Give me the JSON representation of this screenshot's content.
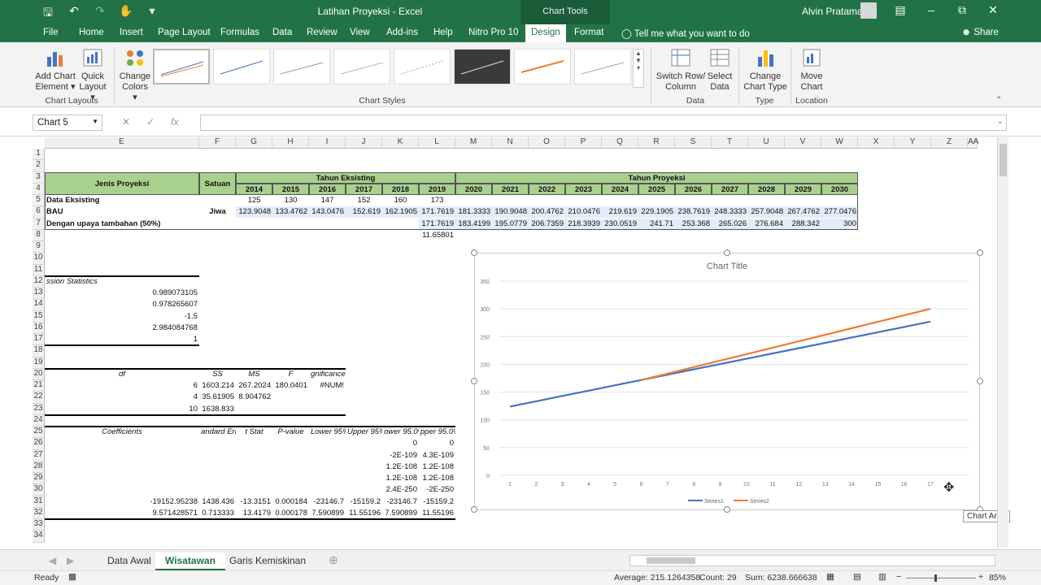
{
  "window": {
    "title": "Latihan Proyeksi  -  Excel",
    "contextual_tab": "Chart Tools",
    "user": "Alvin Pratama"
  },
  "tabs": [
    "File",
    "Home",
    "Insert",
    "Page Layout",
    "Formulas",
    "Data",
    "Review",
    "View",
    "Add-ins",
    "Help",
    "Nitro Pro 10",
    "Design",
    "Format"
  ],
  "tell_me": "Tell me what you want to do",
  "share": "Share",
  "ribbon": {
    "add_chart": "Add Chart",
    "add_chart2": "Element",
    "quick": "Quick",
    "quick2": "Layout",
    "change_colors": "Change",
    "change_colors2": "Colors",
    "group_layouts": "Chart Layouts",
    "group_styles": "Chart Styles",
    "switch": "Switch Row/",
    "switch2": "Column",
    "select": "Select",
    "select2": "Data",
    "group_data": "Data",
    "change_type": "Change",
    "change_type2": "Chart Type",
    "group_type": "Type",
    "move": "Move",
    "move2": "Chart",
    "group_location": "Location"
  },
  "namebox": "Chart 5",
  "columns": [
    "E",
    "F",
    "G",
    "H",
    "I",
    "J",
    "K",
    "L",
    "M",
    "N",
    "O",
    "P",
    "Q",
    "R",
    "S",
    "T",
    "U",
    "V",
    "W",
    "X",
    "Y",
    "Z",
    "AA"
  ],
  "rows": [
    "1",
    "2",
    "3",
    "4",
    "5",
    "6",
    "7",
    "8",
    "9",
    "10",
    "11",
    "12",
    "13",
    "14",
    "15",
    "16",
    "17",
    "18",
    "19",
    "20",
    "21",
    "22",
    "23",
    "24",
    "25",
    "26",
    "27",
    "28",
    "29",
    "30",
    "31",
    "32",
    "33",
    "34"
  ],
  "table": {
    "jenis": "Jenis Proyeksi",
    "satuan": "Satuan",
    "tahun_eksisting": "Tahun Eksisting",
    "tahun_proyeksi": "Tahun Proyeksi",
    "years": [
      "2014",
      "2015",
      "2016",
      "2017",
      "2018",
      "2019",
      "2020",
      "2021",
      "2022",
      "2023",
      "2024",
      "2025",
      "2026",
      "2027",
      "2028",
      "2029",
      "2030"
    ],
    "row_data": "Data Eksisting",
    "row_bau": "BAU",
    "row_upaya": "Dengan upaya tambahan (50%)",
    "jiwa": "Jiwa",
    "eksisting": [
      "125",
      "130",
      "147",
      "152",
      "160",
      "173"
    ],
    "bau": [
      "123.9048",
      "133.4762",
      "143.0476",
      "152.619",
      "162.1905",
      "171.7619",
      "181.3333",
      "190.9048",
      "200.4762",
      "210.0476",
      "219.619",
      "229.1905",
      "238.7619",
      "248.3333",
      "257.9048",
      "267.4762",
      "277.0476"
    ],
    "upaya": [
      "171.7619",
      "183.4199",
      "195.0779",
      "206.7359",
      "218.3939",
      "230.0519",
      "241.71",
      "253.368",
      "265.026",
      "276.684",
      "288.342",
      "300"
    ],
    "l8": "11.65801"
  },
  "regression": {
    "header": "ssion Statistics",
    "stats": [
      "0.989073105",
      "0.978265607",
      "-1.5",
      "2.984084768",
      "1"
    ],
    "anova_headers": [
      "df",
      "SS",
      "MS",
      "F",
      "gnificance F"
    ],
    "anova": [
      [
        "6",
        "1603.214",
        "267.2024",
        "180.0401",
        "#NUM!"
      ],
      [
        "4",
        "35.61905",
        "8.904762",
        "",
        ""
      ],
      [
        "10",
        "1638.833",
        "",
        "",
        ""
      ]
    ],
    "coef_headers": [
      "Coefficients",
      "andard Erro",
      "t Stat",
      "P-value",
      "Lower 95%",
      "Upper 95%",
      "ower 95.0%",
      "pper 95.0%"
    ],
    "small_rows": [
      [
        "0",
        "0"
      ],
      [
        "-2E-109",
        "4.3E-109"
      ],
      [
        "1.2E-108",
        "1.2E-108"
      ],
      [
        "1.2E-108",
        "1.2E-108"
      ],
      [
        "2.4E-250",
        "-2E-250"
      ]
    ],
    "coef_rows": [
      [
        "-19152.95238",
        "1438.436",
        "-13.3151",
        "0.000184",
        "-23146.7",
        "-15159.2",
        "-23146.7",
        "-15159.2"
      ],
      [
        "9.571428571",
        "0.713333",
        "13.4179",
        "0.000178",
        "7.590899",
        "11.55196",
        "7.590899",
        "11.55196"
      ]
    ]
  },
  "chart_data": {
    "type": "line",
    "title": "Chart Title",
    "x": [
      1,
      2,
      3,
      4,
      5,
      6,
      7,
      8,
      9,
      10,
      11,
      12,
      13,
      14,
      15,
      16,
      17
    ],
    "ylim": [
      0,
      350
    ],
    "yticks": [
      "0",
      "50",
      "100",
      "150",
      "200",
      "250",
      "300",
      "350"
    ],
    "series": [
      {
        "name": "Series1",
        "color": "#4472c4",
        "values": [
          123.9048,
          133.4762,
          143.0476,
          152.619,
          162.1905,
          171.7619,
          181.3333,
          190.9048,
          200.4762,
          210.0476,
          219.619,
          229.1905,
          238.7619,
          248.3333,
          257.9048,
          267.4762,
          277.0476
        ]
      },
      {
        "name": "Series2",
        "color": "#ed7d31",
        "values": [
          null,
          null,
          null,
          null,
          null,
          171.7619,
          183.4199,
          195.0779,
          206.7359,
          218.3939,
          230.0519,
          241.71,
          253.368,
          265.026,
          276.684,
          288.342,
          300
        ]
      }
    ],
    "gridlines": true,
    "legend": "bottom"
  },
  "tooltip": "Chart Area",
  "sheets": [
    "Data Awal",
    "Wisatawan",
    "Garis Kemiskinan"
  ],
  "status": {
    "ready": "Ready",
    "average": "Average: 215.1264358",
    "count": "Count: 29",
    "sum": "Sum: 6238.666638",
    "zoom": "85%"
  }
}
